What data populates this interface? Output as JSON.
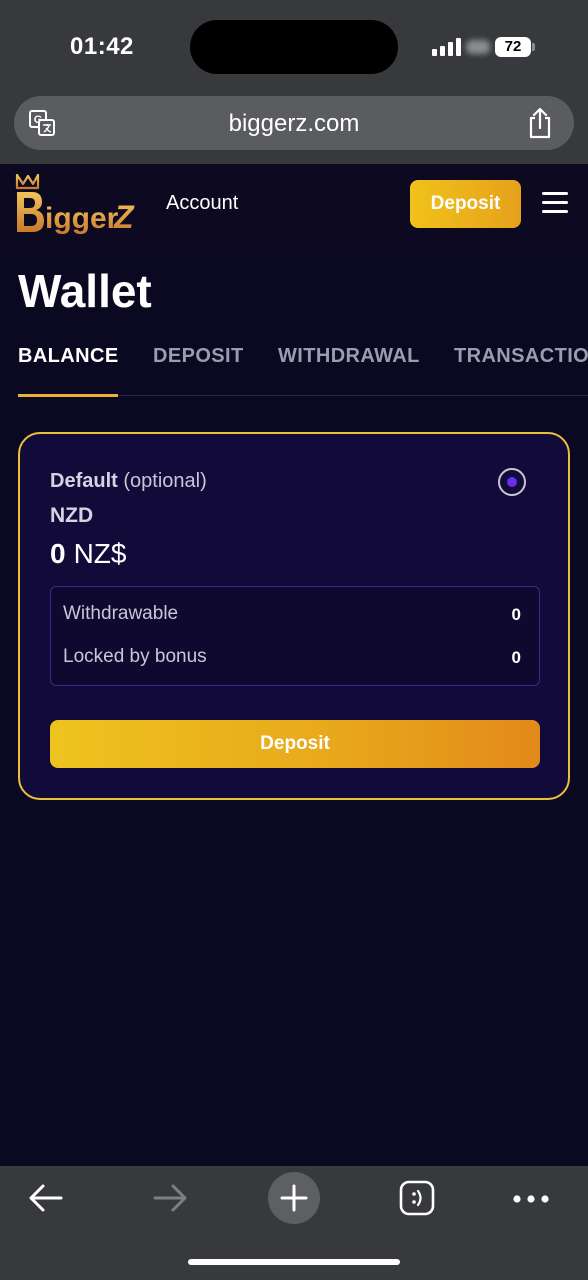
{
  "status_bar": {
    "time": "01:42",
    "battery": "72",
    "icons": [
      "signal-icon",
      "battery-icon"
    ]
  },
  "browser": {
    "address": "biggerz.com",
    "icons": [
      "translate-icon",
      "share-icon"
    ]
  },
  "header": {
    "logo_text": "BiggerZ",
    "account_label": "Account",
    "deposit_label": "Deposit",
    "menu_icon": "hamburger-menu-icon"
  },
  "page": {
    "title": "Wallet",
    "tabs": [
      {
        "label": "BALANCE",
        "active": true
      },
      {
        "label": "DEPOSIT",
        "active": false
      },
      {
        "label": "WITHDRAWAL",
        "active": false
      },
      {
        "label": "TRANSACTIONS",
        "active": false
      }
    ]
  },
  "wallet": {
    "default_label": "Default",
    "optional_label": "(optional)",
    "currency": "NZD",
    "balance_amount": "0",
    "balance_symbol": "NZ$",
    "rows": [
      {
        "label": "Withdrawable",
        "value": "0"
      },
      {
        "label": "Locked by bonus",
        "value": "0"
      }
    ],
    "deposit_label": "Deposit",
    "selected": true
  },
  "toolbar": {
    "icons": [
      "back-arrow-icon",
      "forward-arrow-icon",
      "new-tab-icon",
      "tabs-icon",
      "more-icon"
    ]
  },
  "colors": {
    "accent": "#eabf3a",
    "card_background": "#120b3a",
    "page_background": "#0b0822",
    "radio_selected": "#6a2cf0"
  }
}
